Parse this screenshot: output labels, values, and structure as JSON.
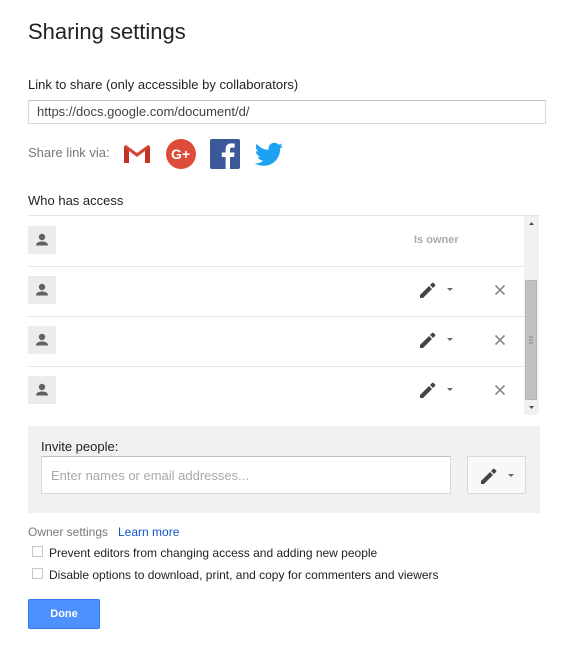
{
  "dialog": {
    "title": "Sharing settings",
    "link_label": "Link to share (only accessible by collaborators)",
    "link_value": "https://docs.google.com/document/d/",
    "share_via_label": "Share link via:",
    "share_icons": [
      "gmail-icon",
      "google-plus-icon",
      "facebook-icon",
      "twitter-icon"
    ],
    "who_has_access_label": "Who has access"
  },
  "access_list": {
    "rows": [
      {
        "role_label": "Is owner",
        "type": "owner"
      },
      {
        "type": "editor",
        "permission_icon": "pencil-icon",
        "remove_icon": "close-icon"
      },
      {
        "type": "editor",
        "permission_icon": "pencil-icon",
        "remove_icon": "close-icon"
      },
      {
        "type": "editor",
        "permission_icon": "pencil-icon",
        "remove_icon": "close-icon"
      }
    ]
  },
  "invite": {
    "label": "Invite people:",
    "placeholder": "Enter names or email addresses...",
    "permission_icon": "pencil-icon"
  },
  "owner_settings": {
    "label": "Owner settings",
    "learn_more": "Learn more",
    "options": [
      {
        "label": "Prevent editors from changing access and adding new people",
        "checked": false
      },
      {
        "label": "Disable options to download, print, and copy for commenters and viewers",
        "checked": false
      }
    ]
  },
  "actions": {
    "done_label": "Done"
  },
  "colors": {
    "gmail_red": "#d44638",
    "google_plus_red": "#dd4b39",
    "facebook_blue": "#3b5998",
    "twitter_blue": "#1da1f2",
    "done_blue": "#4d90fe",
    "link_blue": "#1155cc"
  }
}
